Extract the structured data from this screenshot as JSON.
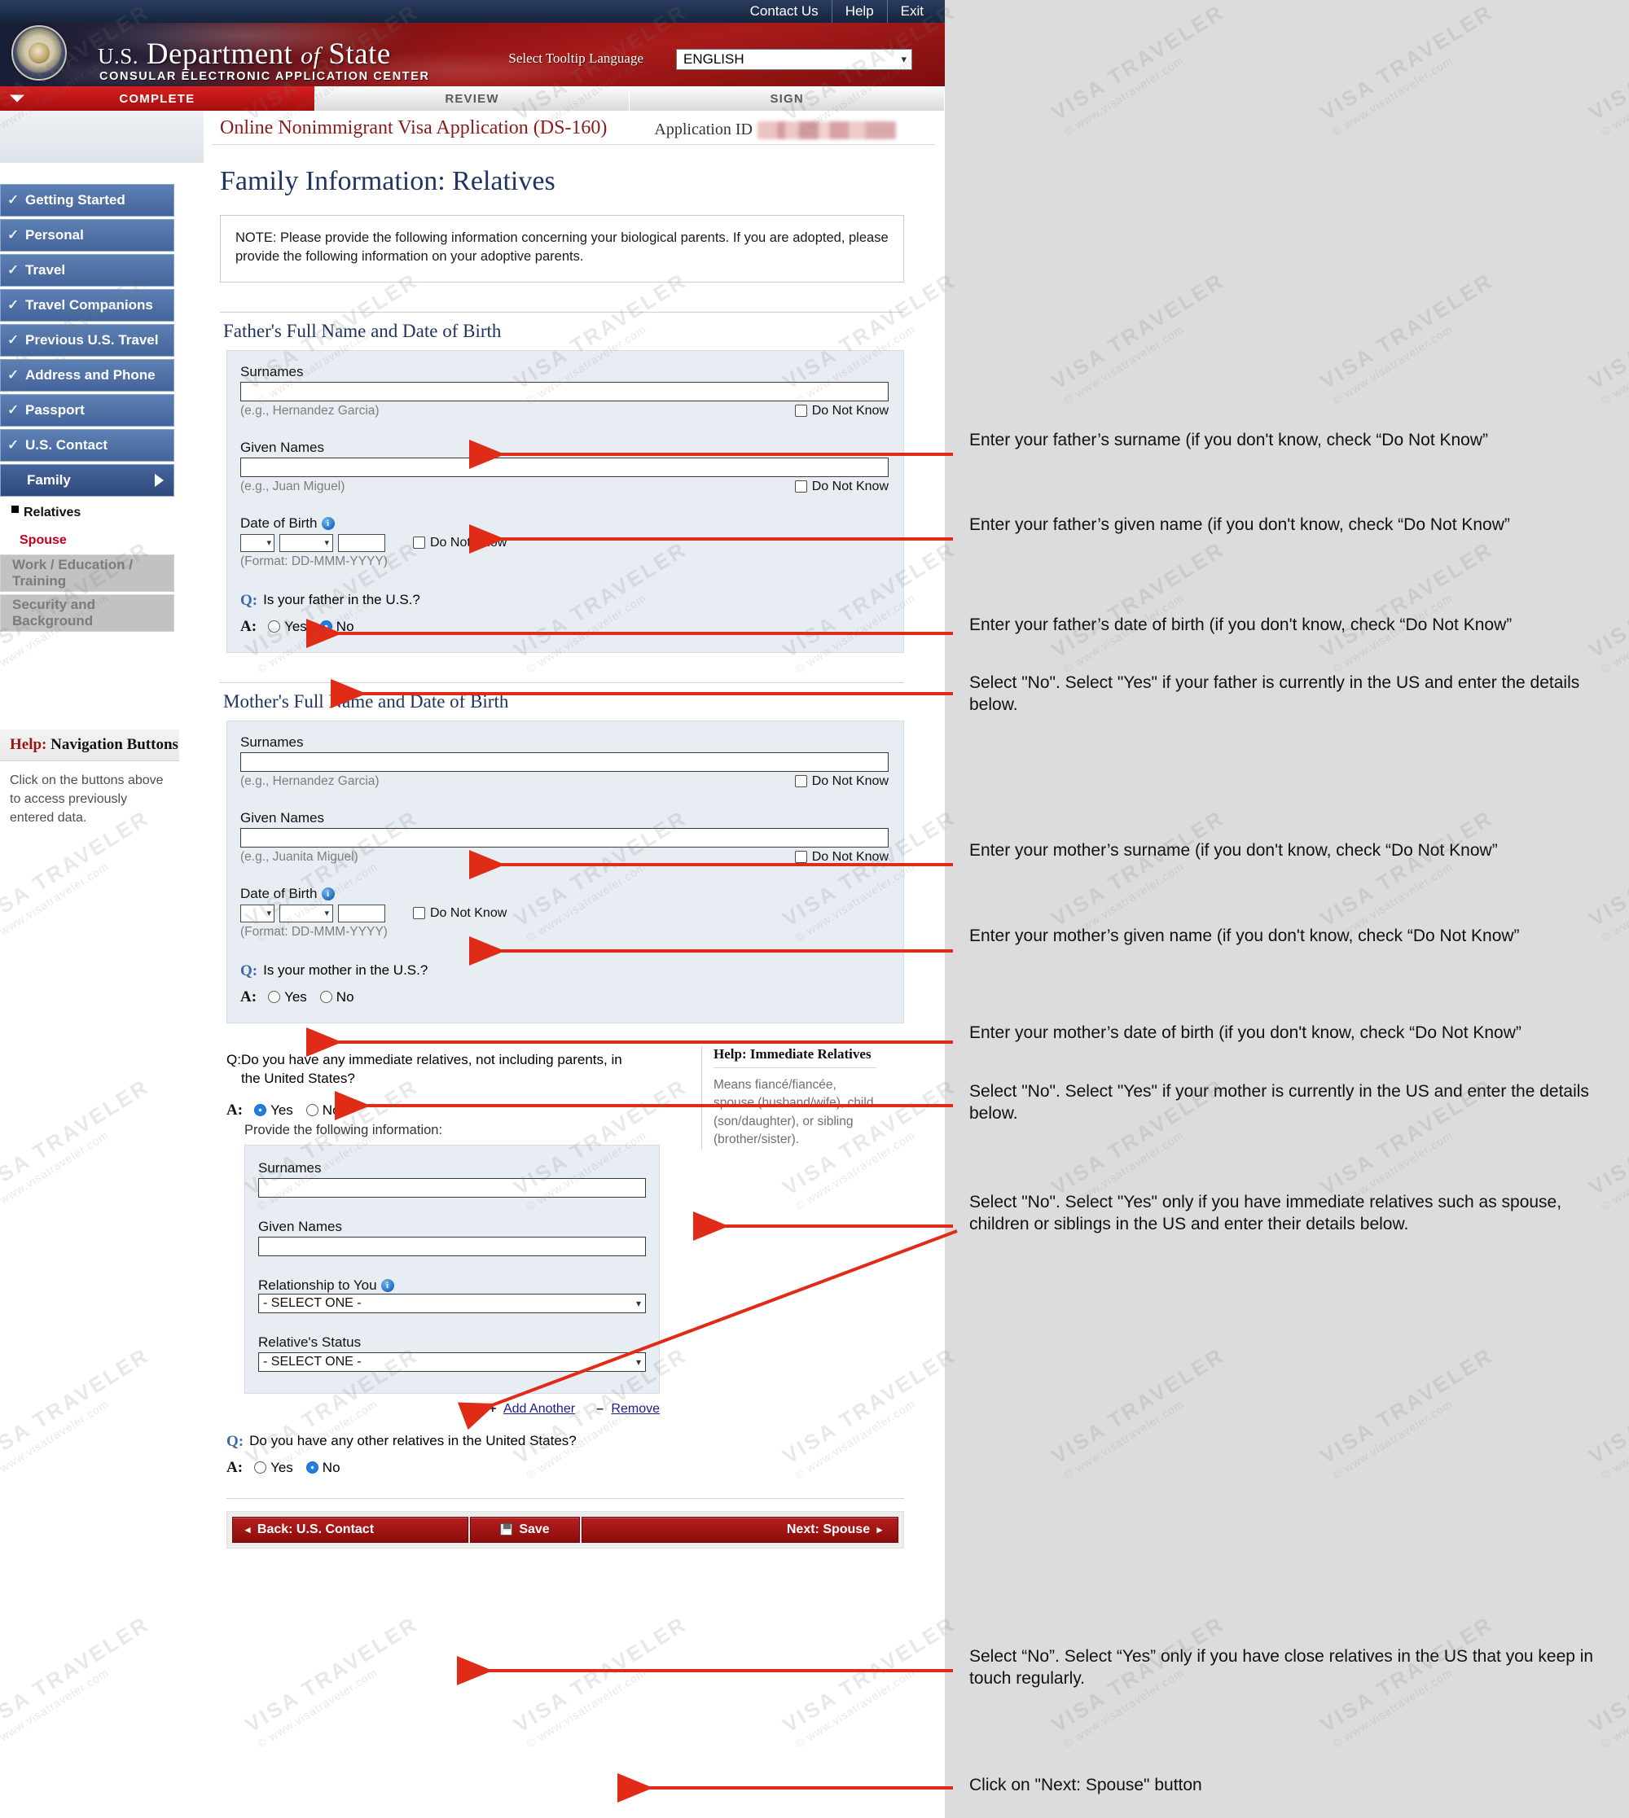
{
  "topbar": {
    "links": [
      "Contact Us",
      "Help",
      "Exit"
    ]
  },
  "banner": {
    "dept_us": "U.S.",
    "dept_department": "Department",
    "dept_of": "of",
    "dept_state": "State",
    "subtitle": "CONSULAR ELECTRONIC APPLICATION CENTER",
    "tooltip_language_label": "Select Tooltip Language",
    "tooltip_language_value": "ENGLISH"
  },
  "steps": [
    {
      "label": "COMPLETE",
      "active": true
    },
    {
      "label": "REVIEW",
      "active": false
    },
    {
      "label": "SIGN",
      "active": false
    }
  ],
  "sidebar": {
    "items": [
      {
        "label": "Getting Started",
        "state": "done"
      },
      {
        "label": "Personal",
        "state": "done"
      },
      {
        "label": "Travel",
        "state": "done"
      },
      {
        "label": "Travel Companions",
        "state": "done"
      },
      {
        "label": "Previous U.S. Travel",
        "state": "done"
      },
      {
        "label": "Address and Phone",
        "state": "done"
      },
      {
        "label": "Passport",
        "state": "done"
      },
      {
        "label": "U.S. Contact",
        "state": "done"
      },
      {
        "label": "Family",
        "state": "current"
      }
    ],
    "sub_items": [
      {
        "label": "Relatives",
        "state": "selected"
      },
      {
        "label": "Spouse",
        "state": "link"
      }
    ],
    "disabled_items": [
      {
        "label": "Work / Education / Training"
      },
      {
        "label": "Security and Background"
      }
    ],
    "help": {
      "title_lead": "Help:",
      "title_rest": "Navigation Buttons",
      "body": "Click on the buttons above to access previously entered data."
    }
  },
  "header": {
    "app_title": "Online Nonimmigrant Visa Application (DS-160)",
    "application_id_label": "Application ID",
    "application_id_value": ""
  },
  "page": {
    "title": "Family Information: Relatives",
    "note": "NOTE: Please provide the following information concerning your biological parents. If you are adopted, please provide the following information on your adoptive parents."
  },
  "father": {
    "section_title": "Father's Full Name and Date of Birth",
    "surnames_label": "Surnames",
    "surnames_value": "",
    "surnames_hint": "(e.g., Hernandez Garcia)",
    "surnames_dnk": "Do Not Know",
    "given_label": "Given Names",
    "given_value": "",
    "given_hint": "(e.g., Juan Miguel)",
    "given_dnk": "Do Not Know",
    "dob_label": "Date of Birth",
    "dob_day": "",
    "dob_month": "",
    "dob_year": "",
    "dob_dnk": "Do Not Know",
    "dob_format": "(Format: DD-MMM-YYYY)",
    "question": "Is your father in the U.S.?",
    "q_marker": "Q:",
    "a_marker": "A:",
    "opt_yes": "Yes",
    "opt_no": "No",
    "selected": "No"
  },
  "mother": {
    "section_title": "Mother's Full Name and Date of Birth",
    "surnames_label": "Surnames",
    "surnames_value": "",
    "surnames_hint": "(e.g., Hernandez Garcia)",
    "surnames_dnk": "Do Not Know",
    "given_label": "Given Names",
    "given_value": "",
    "given_hint": "(e.g., Juanita Miguel)",
    "given_dnk": "Do Not Know",
    "dob_label": "Date of Birth",
    "dob_day": "",
    "dob_month": "",
    "dob_year": "",
    "dob_dnk": "Do Not Know",
    "dob_format": "(Format: DD-MMM-YYYY)",
    "question": "Is your mother in the U.S.?",
    "q_marker": "Q:",
    "a_marker": "A:",
    "opt_yes": "Yes",
    "opt_no": "No",
    "selected": ""
  },
  "immediate_relatives": {
    "q_marker": "Q:",
    "a_marker": "A:",
    "question": "Do you have any immediate relatives, not including parents, in the United States?",
    "opt_yes": "Yes",
    "opt_no": "No",
    "selected": "Yes",
    "provide": "Provide the following information:",
    "help_title_lead": "Help:",
    "help_title_rest": "Immediate Relatives",
    "help_body": "Means fiancé/fiancée, spouse (husband/wife), child (son/daughter), or sibling (brother/sister).",
    "surnames_label": "Surnames",
    "surnames_value": "",
    "given_label": "Given Names",
    "given_value": "",
    "relationship_label": "Relationship to You",
    "relationship_value": "- SELECT ONE -",
    "status_label": "Relative's Status",
    "status_value": "- SELECT ONE -",
    "add_another": "Add Another",
    "remove": "Remove",
    "add_sign": "+",
    "remove_sign": "–"
  },
  "other_relatives": {
    "q_marker": "Q:",
    "a_marker": "A:",
    "question": "Do you have any other relatives in the United States?",
    "opt_yes": "Yes",
    "opt_no": "No",
    "selected": "No"
  },
  "buttons": {
    "back": "Back: U.S. Contact",
    "save": "Save",
    "next": "Next: Spouse",
    "back_caret": "◄",
    "next_caret": "►"
  },
  "annotations": [
    {
      "text": "Enter your father’s surname (if you don't know, check “Do Not Know”"
    },
    {
      "text": "Enter your father’s given name (if you don't know, check “Do Not Know”"
    },
    {
      "text": "Enter your father’s date of birth (if you don't know, check “Do Not Know”"
    },
    {
      "text": "Select \"No\". Select \"Yes\" if your father is currently in the US and enter the details below."
    },
    {
      "text": "Enter your mother’s surname (if you don't know, check “Do Not Know”"
    },
    {
      "text": "Enter your mother’s given name (if you don't know, check “Do Not Know”"
    },
    {
      "text": "Enter your mother’s date of birth (if you don't know, check “Do Not Know”"
    },
    {
      "text": "Select \"No\". Select \"Yes\" if your mother is currently in the US and enter the details below."
    },
    {
      "text": "Select \"No\". Select \"Yes\" only if you have immediate relatives such as spouse, children or siblings in the US and enter their details below."
    },
    {
      "text": "Select “No”. Select “Yes” only if you have close relatives in the US that you keep in touch regularly."
    },
    {
      "text": "Click on \"Next: Spouse\" button"
    }
  ],
  "watermark": {
    "line1": "VISA TRAVELER",
    "line2": "© www.visatraveler.com"
  },
  "colors": {
    "accent_red": "#a60d0d",
    "nav_blue": "#44659b",
    "heading_blue": "#1f3461",
    "arrow_red": "#e02b16",
    "link_red": "#c00020"
  }
}
